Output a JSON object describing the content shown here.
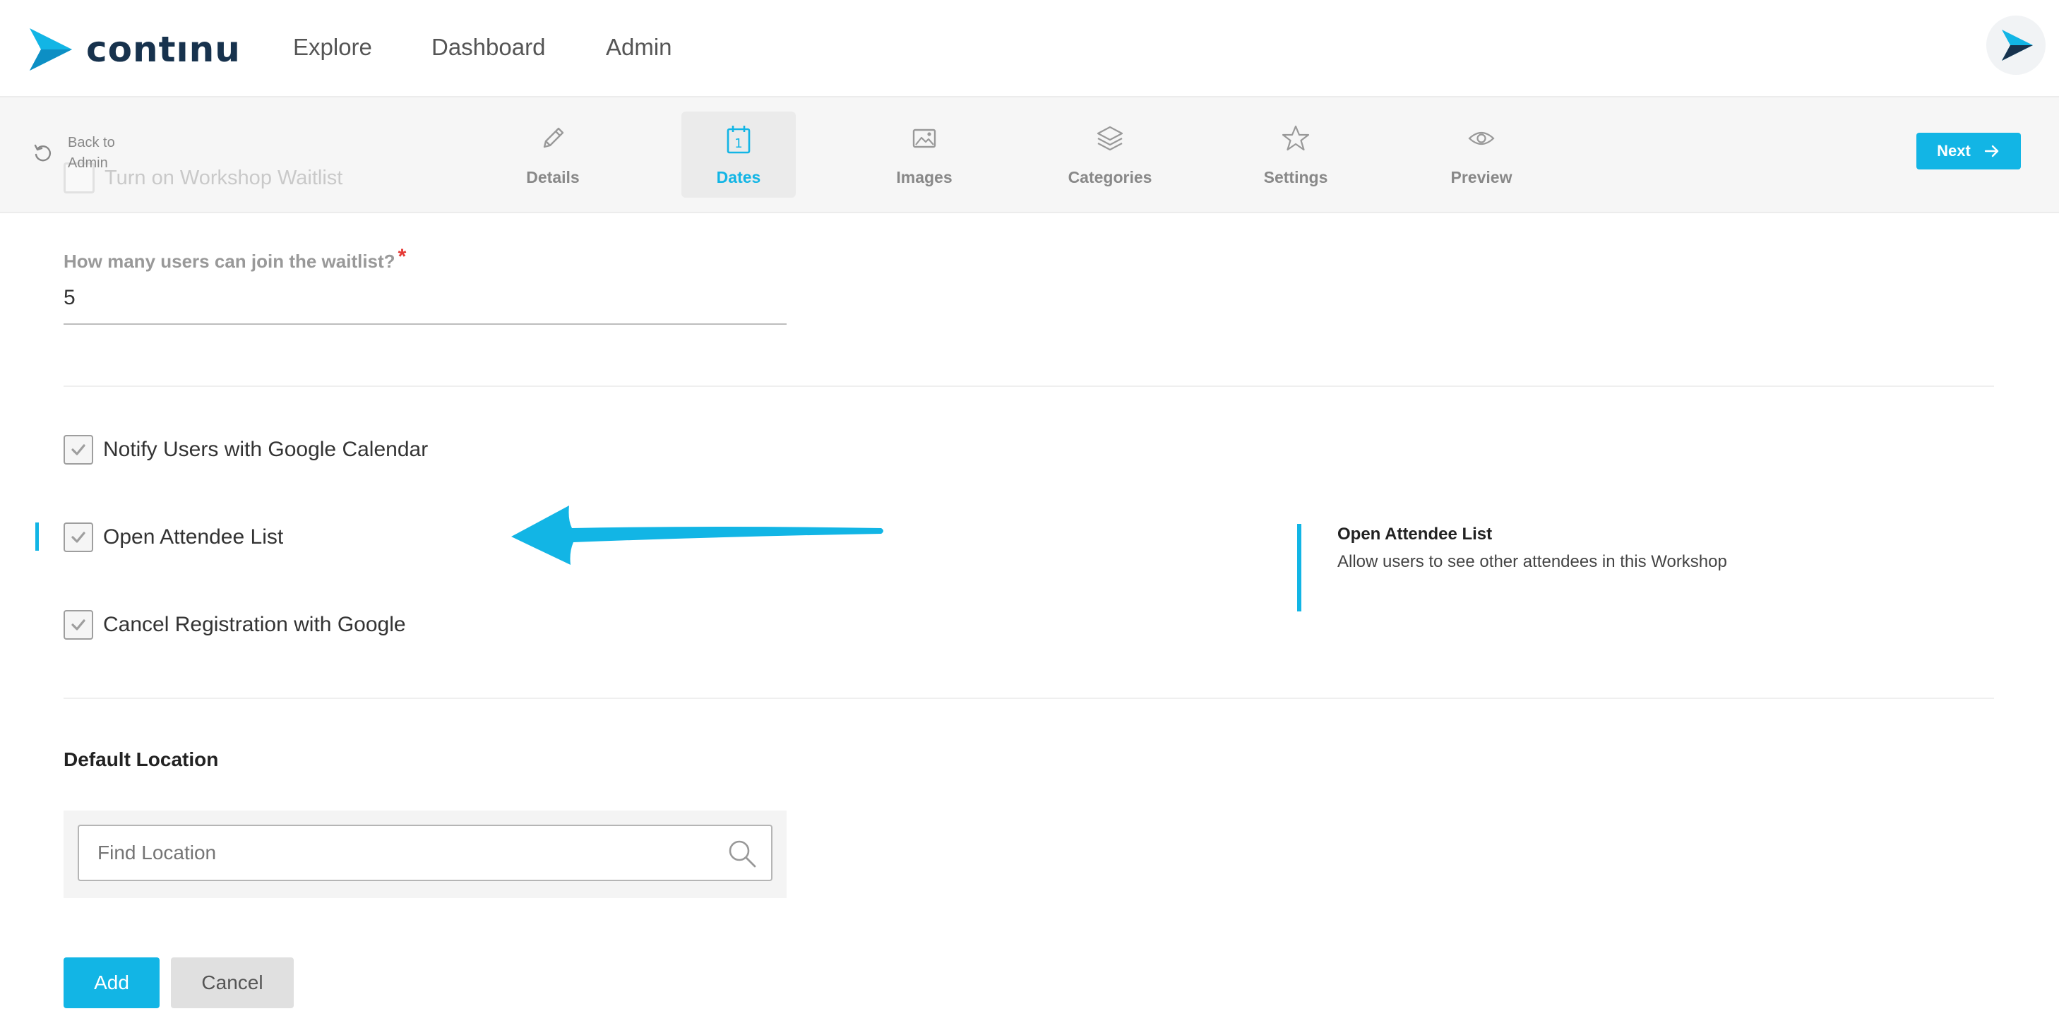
{
  "header": {
    "logo_text": "contınu",
    "nav": [
      {
        "label": "Explore"
      },
      {
        "label": "Dashboard"
      },
      {
        "label": "Admin"
      }
    ]
  },
  "stepbar": {
    "back_label": "Back to Admin",
    "ghost_label": "Turn on Workshop Waitlist",
    "steps": [
      {
        "label": "Details",
        "icon": "pencil-icon",
        "active": false
      },
      {
        "label": "Dates",
        "icon": "calendar-icon",
        "active": true
      },
      {
        "label": "Images",
        "icon": "image-icon",
        "active": false
      },
      {
        "label": "Categories",
        "icon": "layers-icon",
        "active": false
      },
      {
        "label": "Settings",
        "icon": "star-icon",
        "active": false
      },
      {
        "label": "Preview",
        "icon": "eye-icon",
        "active": false
      }
    ],
    "next_label": "Next"
  },
  "waitlist": {
    "question": "How many users can join the waitlist?",
    "required_mark": "*",
    "value": "5"
  },
  "options": [
    {
      "label": "Notify Users with Google Calendar",
      "checked": true
    },
    {
      "label": "Open Attendee List",
      "checked": true
    },
    {
      "label": "Cancel Registration with Google",
      "checked": true
    }
  ],
  "help": {
    "title": "Open Attendee List",
    "description": "Allow users to see other attendees in this Workshop"
  },
  "location": {
    "title": "Default Location",
    "placeholder": "Find Location"
  },
  "actions": {
    "add_label": "Add",
    "cancel_label": "Cancel"
  },
  "colors": {
    "accent": "#12b5e5",
    "brand_dark": "#17324d",
    "required": "#e53935"
  }
}
